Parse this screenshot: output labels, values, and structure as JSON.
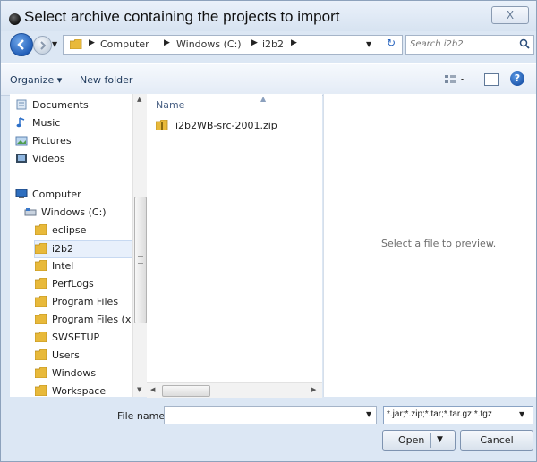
{
  "window": {
    "title": "Select archive containing the projects to import",
    "close_label": "X"
  },
  "navigation": {
    "breadcrumbs": [
      "Computer",
      "Windows (C:)",
      "i2b2"
    ],
    "search_placeholder": "Search i2b2"
  },
  "toolbar": {
    "organize_label": "Organize ▾",
    "new_folder_label": "New folder",
    "help_label": "?"
  },
  "sidebar": {
    "items": [
      {
        "label": "Documents",
        "icon": "documents-library-icon"
      },
      {
        "label": "Music",
        "icon": "music-library-icon"
      },
      {
        "label": "Pictures",
        "icon": "pictures-library-icon"
      },
      {
        "label": "Videos",
        "icon": "videos-library-icon"
      },
      {
        "label": "Computer",
        "icon": "computer-icon"
      },
      {
        "label": "Windows (C:)",
        "icon": "drive-icon"
      },
      {
        "label": "eclipse",
        "icon": "folder-icon"
      },
      {
        "label": "i2b2",
        "icon": "folder-icon",
        "selected": true
      },
      {
        "label": "Intel",
        "icon": "folder-icon"
      },
      {
        "label": "PerfLogs",
        "icon": "folder-icon"
      },
      {
        "label": "Program Files",
        "icon": "folder-icon"
      },
      {
        "label": "Program Files (x",
        "icon": "folder-icon"
      },
      {
        "label": "SWSETUP",
        "icon": "folder-icon"
      },
      {
        "label": "Users",
        "icon": "folder-icon"
      },
      {
        "label": "Windows",
        "icon": "folder-icon"
      },
      {
        "label": "Workspace",
        "icon": "folder-icon"
      }
    ]
  },
  "file_list": {
    "column_header": "Name",
    "files": [
      {
        "name": "i2b2WB-src-2001.zip",
        "icon": "zip-archive-icon"
      }
    ]
  },
  "preview": {
    "message": "Select a file to preview."
  },
  "footer": {
    "file_name_label": "File name:",
    "file_name_value": "",
    "file_type_filter": "*.jar;*.zip;*.tar;*.tar.gz;*.tgz",
    "open_label": "Open",
    "cancel_label": "Cancel"
  },
  "colors": {
    "chrome_background": "#dce7f4",
    "folder_yellow": "#e8b93a",
    "selection_highlight": "#e8f0fb",
    "accent_blue": "#1e5bb6"
  }
}
